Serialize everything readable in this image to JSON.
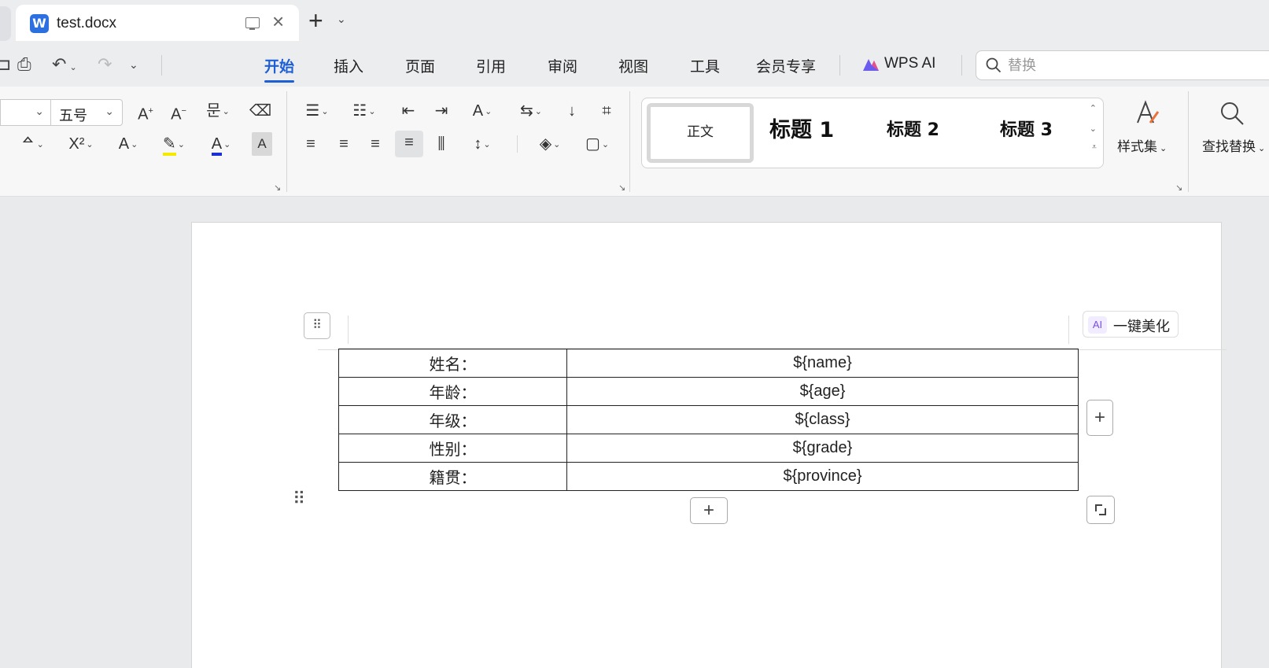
{
  "tabs": {
    "active_title": "test.docx",
    "new_tab": "+",
    "close": "×"
  },
  "menu": {
    "items": [
      "开始",
      "插入",
      "页面",
      "引用",
      "审阅",
      "视图",
      "工具",
      "会员专享"
    ],
    "active": "开始",
    "wps_ai": "WPS AI",
    "search_placeholder": "替换"
  },
  "ribbon": {
    "font_size": "五号",
    "styles": {
      "normal": "正文",
      "h1": "标题 1",
      "h2": "标题 2",
      "h3": "标题 3"
    },
    "style_set_label": "样式集",
    "find_replace_label": "查找替换"
  },
  "doc": {
    "beautify": {
      "ai_badge": "AI",
      "label": "一键美化"
    },
    "table": [
      {
        "label": "姓名：",
        "value": "${name}"
      },
      {
        "label": "年龄：",
        "value": "${age}"
      },
      {
        "label": "年级：",
        "value": "${class}"
      },
      {
        "label": "性别：",
        "value": "${grade}"
      },
      {
        "label": "籍贯：",
        "value": "${province}"
      }
    ]
  },
  "colors": {
    "accent": "#1d5fd6",
    "highlight": "#f5e900",
    "font_color": "#1a2fd6",
    "wps_logo": "#2b6fe0"
  }
}
